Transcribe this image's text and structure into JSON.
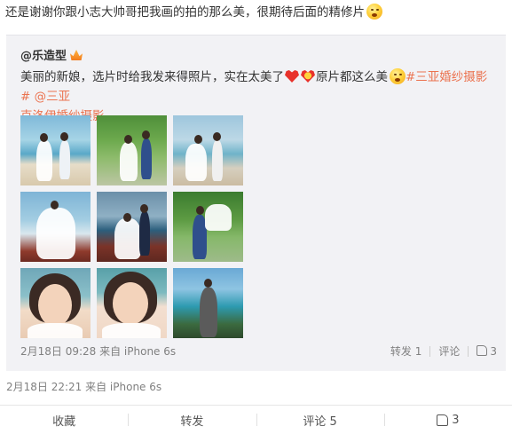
{
  "post": {
    "text": "还是谢谢你跟小志大帅哥把我画的拍的那么美，很期待后面的精修片",
    "emoji": "shy-face-icon",
    "meta": "2月18日 22:21 来自 iPhone 6s"
  },
  "repost": {
    "author": "@乐造型",
    "author_badge": "crown-icon",
    "text_part1": "美丽的新娘，选片时给我发来得照片，实在太美了",
    "text_part2": "原片都这么美",
    "tag1": "#三亚婚纱摄影#",
    "mention": "@三亚",
    "text_line2": "克洛伊婚纱摄影",
    "images": [
      "beach-couple-photo",
      "garden-couple-photo",
      "sea-couple-photo",
      "balcony-bride-photo",
      "balcony-couple-photo",
      "garden-lift-photo",
      "bride-closeup-photo",
      "bride-smile-photo",
      "groom-beach-photo"
    ],
    "meta": "2月18日 09:28 来自 iPhone 6s",
    "forward": "转发 1",
    "comment": "评论",
    "likes": "3"
  },
  "actions": {
    "favorite": "收藏",
    "forward": "转发",
    "comment": "评论 5",
    "likes": "3"
  },
  "colors": {
    "accent": "#eb7350",
    "repost_bg": "#f2f2f5",
    "meta_text": "#808080"
  }
}
